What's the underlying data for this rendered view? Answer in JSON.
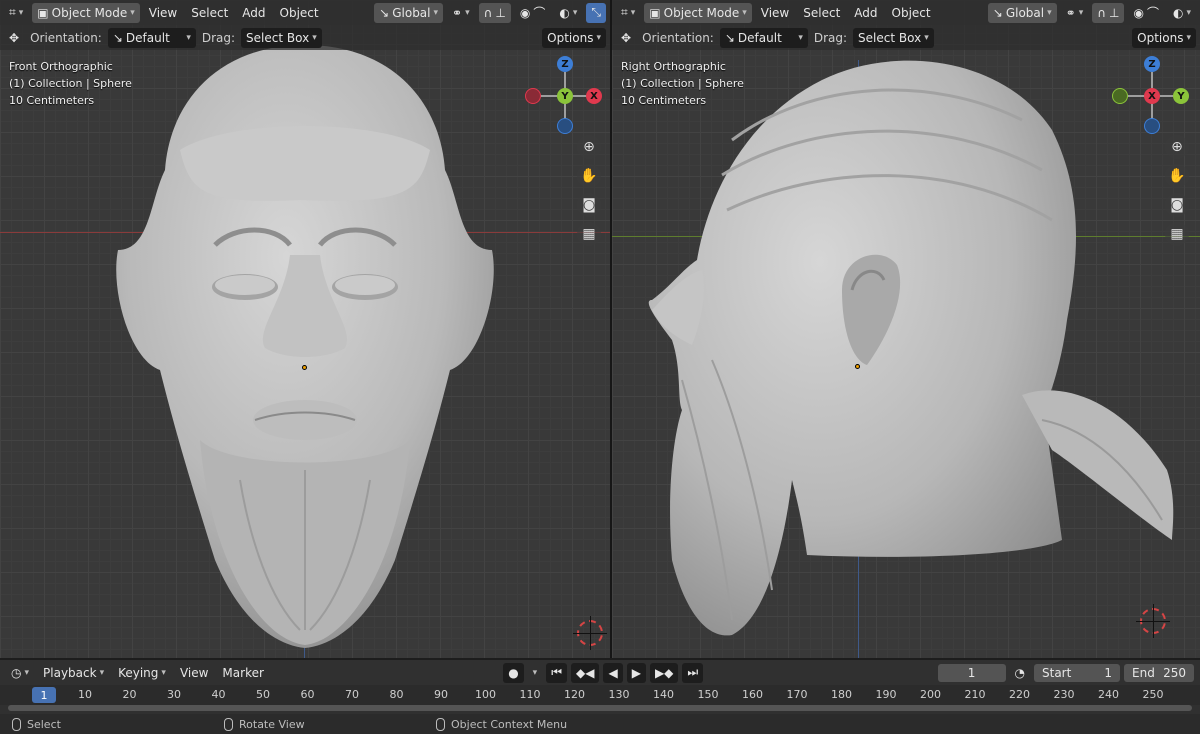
{
  "left_viewport": {
    "header": {
      "mode": "Object Mode",
      "menu": [
        "View",
        "Select",
        "Add",
        "Object"
      ],
      "transform_space": "Global"
    },
    "tool_settings": {
      "orientation_label": "Orientation:",
      "orientation_value": "Default",
      "drag_label": "Drag:",
      "drag_value": "Select Box",
      "options_label": "Options"
    },
    "info": {
      "view_name": "Front Orthographic",
      "collection": "(1) Collection | Sphere",
      "scale": "10 Centimeters"
    },
    "gizmo": {
      "top": "Z",
      "center": "Y",
      "right": "X"
    }
  },
  "right_viewport": {
    "header": {
      "mode": "Object Mode",
      "menu": [
        "View",
        "Select",
        "Add",
        "Object"
      ],
      "transform_space": "Global"
    },
    "tool_settings": {
      "orientation_label": "Orientation:",
      "orientation_value": "Default",
      "drag_label": "Drag:",
      "drag_value": "Select Box",
      "options_label": "Options"
    },
    "info": {
      "view_name": "Right Orthographic",
      "collection": "(1) Collection | Sphere",
      "scale": "10 Centimeters"
    },
    "gizmo": {
      "top": "Z",
      "center": "X",
      "right": "Y"
    }
  },
  "timeline": {
    "menu": [
      "Playback",
      "Keying",
      "View",
      "Marker"
    ],
    "current_frame": "1",
    "start_label": "Start",
    "start_value": "1",
    "end_label": "End",
    "end_value": "250",
    "ruler": [
      "10",
      "20",
      "30",
      "40",
      "50",
      "60",
      "70",
      "80",
      "90",
      "100",
      "110",
      "120",
      "130",
      "140",
      "150",
      "160",
      "170",
      "180",
      "190",
      "200",
      "210",
      "220",
      "230",
      "240",
      "250"
    ],
    "ruler_current": "1"
  },
  "status_bar": {
    "select": "Select",
    "rotate": "Rotate View",
    "context": "Object Context Menu"
  },
  "colors": {
    "accent": "#4772b3",
    "axis_x": "#e0394e",
    "axis_y": "#8bc43a",
    "axis_z": "#3d7ed6",
    "viewport_bg": "#393939"
  }
}
